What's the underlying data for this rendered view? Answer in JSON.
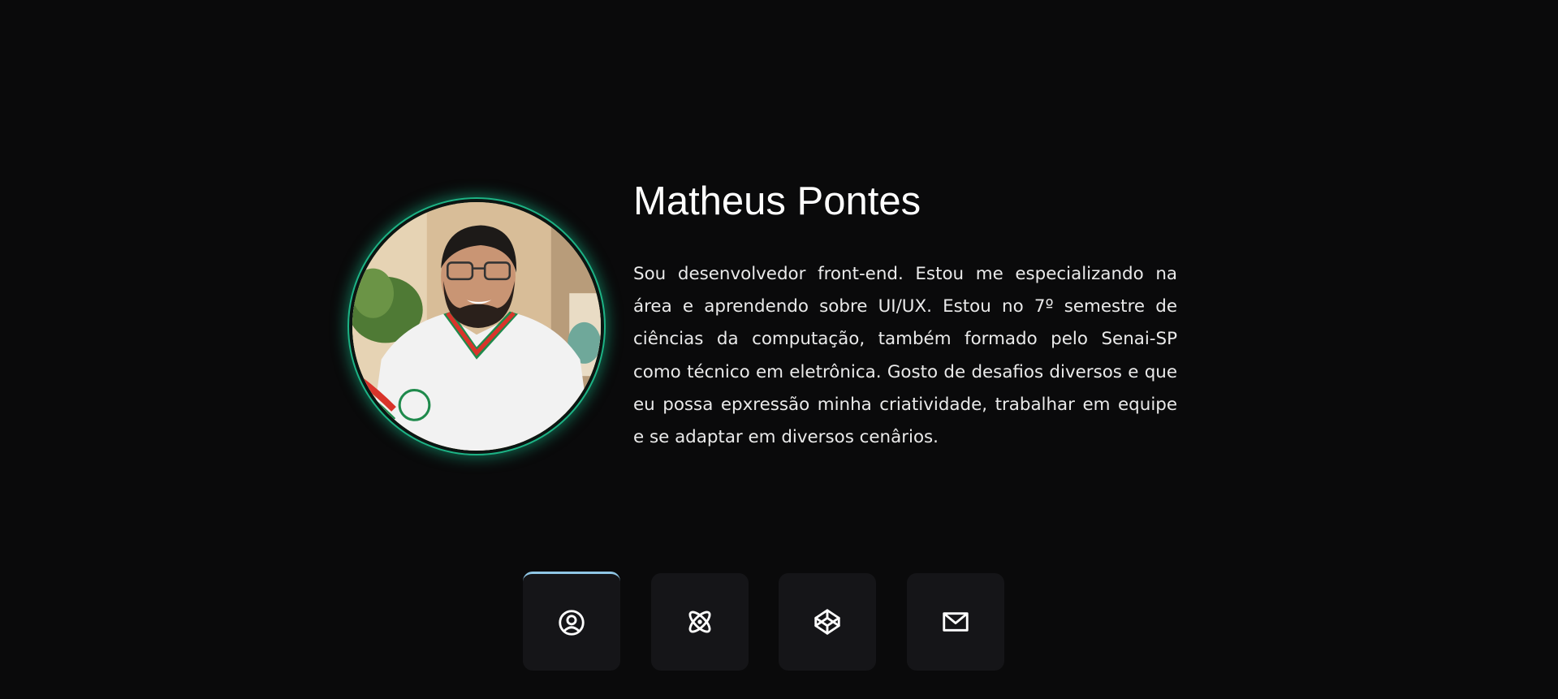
{
  "profile": {
    "name": "Matheus Pontes",
    "bio": "Sou desenvolvedor front-end. Estou me especializando na área e aprendendo sobre UI/UX. Estou no 7º semestre de ciências da computação, também formado pelo Senai-SP como técnico em eletrônica. Gosto de desafios diversos e que eu possa epxressão minha criatividade, trabalhar em equipe e se adaptar em diversos cenârios.",
    "photo_alt": "Matheus Pontes"
  },
  "nav": {
    "items": [
      {
        "icon": "user-circle-icon",
        "active": true
      },
      {
        "icon": "atom-icon",
        "active": false
      },
      {
        "icon": "codepen-icon",
        "active": false
      },
      {
        "icon": "mail-icon",
        "active": false
      }
    ]
  },
  "colors": {
    "background": "#0a0a0b",
    "card": "#151518",
    "photo_glow": "#1db385",
    "active_indicator": "#8fc6e5",
    "text": "#ffffff"
  }
}
